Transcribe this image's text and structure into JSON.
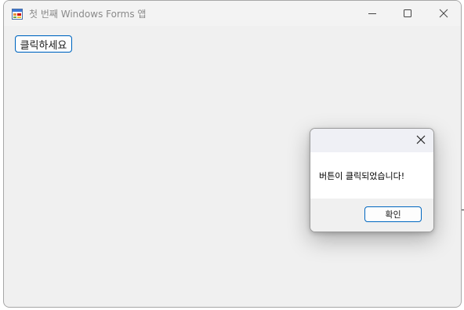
{
  "window": {
    "title": "첫 번째 Windows Forms 앱",
    "minimize_icon": "minimize-icon",
    "maximize_icon": "maximize-icon",
    "close_icon": "close-icon"
  },
  "main": {
    "button_label": "클릭하세요"
  },
  "dialog": {
    "message": "버튼이 클릭되었습니다!",
    "ok_label": "확인",
    "close_icon": "close-icon"
  },
  "colors": {
    "accent": "#0067c0",
    "window_bg": "#f0f0f0",
    "dialog_bg": "#ffffff"
  }
}
